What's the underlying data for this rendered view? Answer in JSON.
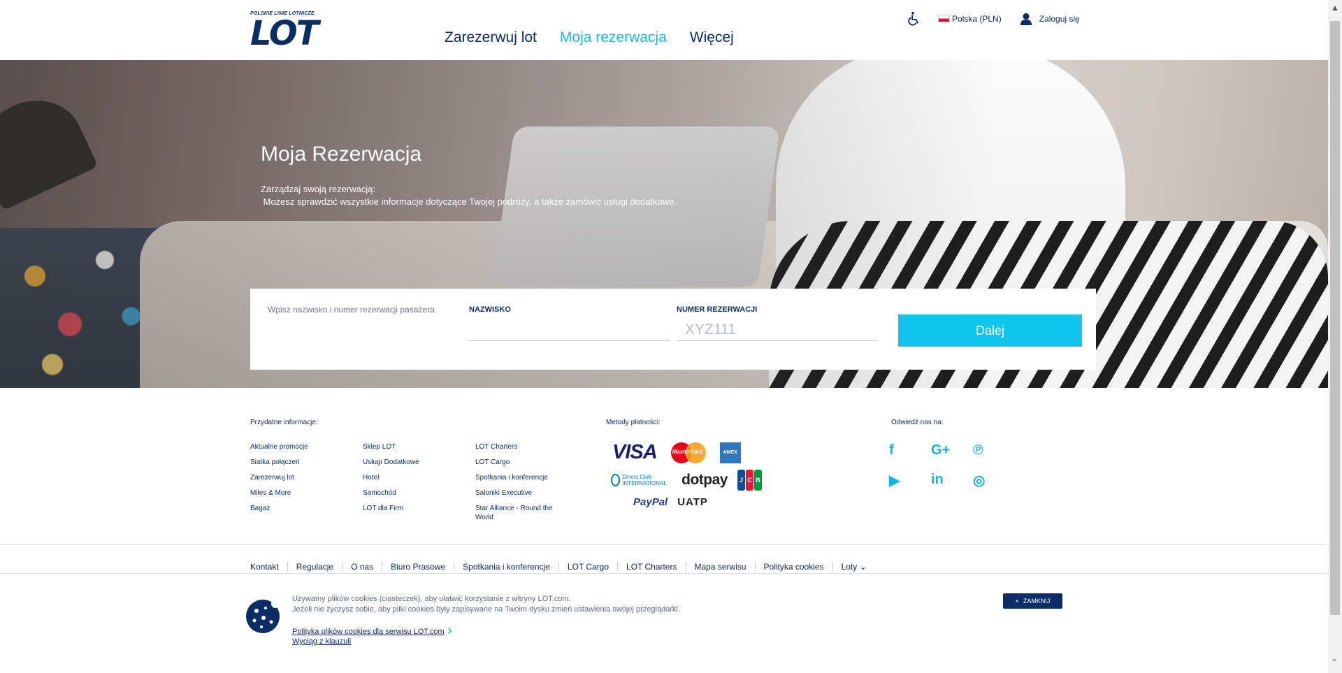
{
  "header": {
    "logo_small": "POLSKIE LINIE LOTNICZE",
    "logo_big": "LOT",
    "nav": [
      {
        "label": "Zarezerwuj lot"
      },
      {
        "label": "Moja rezerwacja"
      },
      {
        "label": "Więcej"
      }
    ],
    "language": "Polska (PLN)",
    "login": "Zaloguj się"
  },
  "hero": {
    "title": "Moja Rezerwacja",
    "subtitle": "Zarządzaj swoją rezerwacją:\n Możesz sprawdzić wszystkie informacje dotyczące Twojej podróży, a także zamówić usługi dodatkowe."
  },
  "booking": {
    "hint": "Wpisz nazwisko i numer rezerwacji pasażera",
    "surname_label": "NAZWISKO",
    "surname_value": "",
    "pnr_label": "NUMER REZERWACJI",
    "pnr_placeholder": "XYZ111",
    "submit": "Dalej"
  },
  "footer": {
    "useful_title": "Przydatne informacje:",
    "col1": [
      "Aktualne promocje",
      "Siatka połączeń",
      "Zarezerwuj lot",
      "Miles & More",
      "Bagaż"
    ],
    "col2": [
      "Sklep LOT",
      "Usługi Dodatkowe",
      "Hotel",
      "Samochód",
      "LOT dla Firm"
    ],
    "col3": [
      "LOT Charters",
      "LOT Cargo",
      "Spotkania i konferencje",
      "Saloniki Executive",
      "Star Alliance - Round the World"
    ],
    "payment_title": "Metody płatności:",
    "payment_logos": {
      "visa": "VISA",
      "mastercard": "MasterCard",
      "amex": "AMEX",
      "diners": "Diners Club INTERNATIONAL",
      "dotpay": "dotpay",
      "jcb": [
        "J",
        "C",
        "B"
      ],
      "paypal": "PayPal",
      "uatp": "UATP"
    },
    "social_title": "Odwiedź nas na:",
    "social_icons": [
      "facebook-icon",
      "google-plus-icon",
      "pinterest-icon",
      "youtube-icon",
      "linkedin-icon",
      "instagram-icon"
    ],
    "social_glyphs": [
      "f",
      "G+",
      "℗",
      "▶",
      "in",
      "◎"
    ]
  },
  "bottom_links": [
    "Kontakt",
    "Regulacje",
    "O nas",
    "Biuro Prasowe",
    "Spotkania i konferencje",
    "LOT Cargo",
    "LOT Charters",
    "Mapa serwisu",
    "Polityka cookies",
    "Loty ⌄"
  ],
  "cookie": {
    "text": "Używamy plików cookies (ciasteczek), aby ułatwić korzystanie z witryny LOT.com.\nJeżeli nie życzysz sobie, aby pliki cookies były zapisywane na Twoim dysku zmień ustawienia swojej przeglądarki.",
    "link1": "Polityka plików cookies dla serwisu LOT.com",
    "link2": "Wyciąg z klauzuli",
    "close": "ZAMKNIJ",
    "close_x": "×"
  },
  "colors": {
    "brand_navy": "#0b2d66",
    "accent_cyan": "#11c5ed"
  }
}
